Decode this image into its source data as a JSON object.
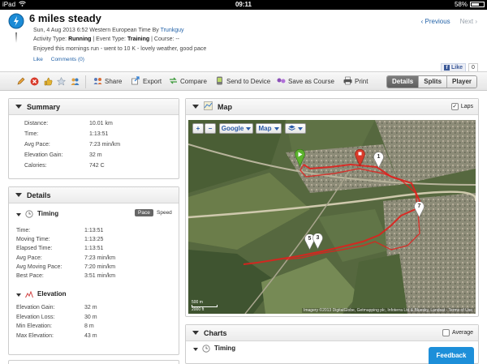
{
  "statusbar": {
    "device": "iPad",
    "time": "09:11",
    "battery": "58%"
  },
  "header": {
    "title": "6 miles steady",
    "date_line_prefix": "Sun, 4 Aug 2013 6:52 Western European Time By ",
    "author": "Trunkguy",
    "activity_type_label": "Activity Type: ",
    "activity_type": "Running",
    "event_type_label": " | Event Type: ",
    "event_type": "Training",
    "course_label": " | Course: --",
    "description": "Enjoyed this mornings run - went to 10 K - lovely weather, good pace",
    "like": "Like",
    "comments": "Comments (0)",
    "previous": "Previous",
    "next": "Next",
    "fb_like": "Like",
    "fb_count": "0"
  },
  "toolbar": {
    "share": "Share",
    "export": "Export",
    "compare": "Compare",
    "send": "Send to Device",
    "save_course": "Save as Course",
    "print": "Print",
    "tabs": [
      "Details",
      "Splits",
      "Player"
    ]
  },
  "summary": {
    "title": "Summary",
    "rows": [
      {
        "k": "Distance:",
        "v": "10.01 km"
      },
      {
        "k": "Time:",
        "v": "1:13:51"
      },
      {
        "k": "Avg Pace:",
        "v": "7:23 min/km"
      },
      {
        "k": "Elevation Gain:",
        "v": "32 m"
      },
      {
        "k": "Calories:",
        "v": "742 C"
      }
    ]
  },
  "details": {
    "title": "Details",
    "timing_title": "Timing",
    "pace": "Pace",
    "speed": "Speed",
    "timing_rows": [
      {
        "k": "Time:",
        "v": "1:13:51"
      },
      {
        "k": "Moving Time:",
        "v": "1:13:25"
      },
      {
        "k": "Elapsed Time:",
        "v": "1:13:51"
      },
      {
        "k": "Avg Pace:",
        "v": "7:23 min/km"
      },
      {
        "k": "Avg Moving Pace:",
        "v": "7:20 min/km"
      },
      {
        "k": "Best Pace:",
        "v": "3:51 min/km"
      }
    ],
    "elevation_title": "Elevation",
    "elevation_rows": [
      {
        "k": "Elevation Gain:",
        "v": "32 m"
      },
      {
        "k": "Elevation Loss:",
        "v": "30 m"
      },
      {
        "k": "Min Elevation:",
        "v": "8 m"
      },
      {
        "k": "Max Elevation:",
        "v": "43 m"
      }
    ]
  },
  "map": {
    "title": "Map",
    "laps": "Laps",
    "provider": "Google",
    "type": "Map",
    "markers": [
      "1",
      "7",
      "5",
      "3"
    ],
    "scale_top": "500 m",
    "scale_bottom": "2000 ft",
    "attribution": "Imagery ©2013 DigitalGlobe, Getmapping plc, Infoterra Ltd & Bluesky, Landsat - Terms of Use"
  },
  "charts": {
    "title": "Charts",
    "average": "Average",
    "timing": "Timing"
  },
  "feedback": "Feedback",
  "colors": {
    "accent": "#2463a8",
    "route": "#e0201d",
    "feedback": "#1d8fd9"
  }
}
